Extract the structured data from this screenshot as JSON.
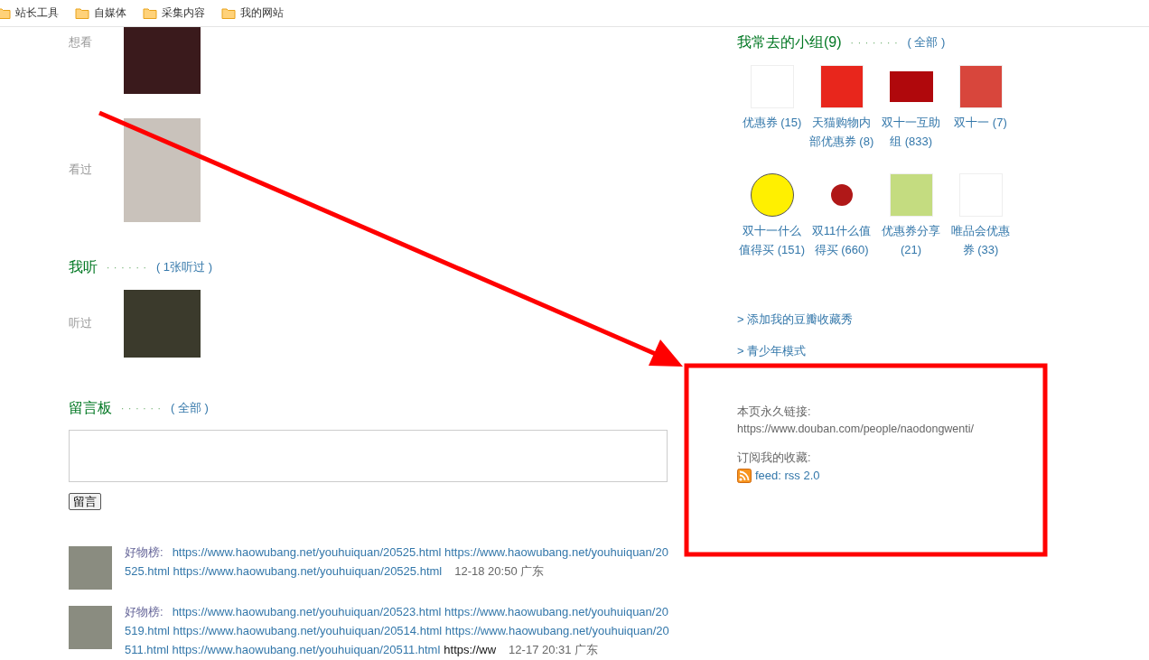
{
  "bookmarks": [
    {
      "label": "站长工具"
    },
    {
      "label": "自媒体"
    },
    {
      "label": "采集内容"
    },
    {
      "label": "我的网站"
    }
  ],
  "watch": {
    "rows": [
      {
        "label": "想看"
      },
      {
        "label": "看过"
      }
    ]
  },
  "listen": {
    "title": "我听",
    "dots": "· · · · · ·",
    "link": "( 1张听过 )",
    "rows": [
      {
        "label": "听过"
      }
    ]
  },
  "board": {
    "title": "留言板",
    "dots": "· · · · · ·",
    "link": "( 全部 )",
    "submit": "留言"
  },
  "comments": [
    {
      "author": "好物榜:",
      "links": "https://www.haowubang.net/youhuiquan/20525.html https://www.haowubang.net/youhuiquan/20525.html https://www.haowubang.net/youhuiquan/20525.html",
      "meta": "12-18 20:50 广东"
    },
    {
      "author": "好物榜:",
      "links": "https://www.haowubang.net/youhuiquan/20523.html https://www.haowubang.net/youhuiquan/20519.html https://www.haowubang.net/youhuiquan/20514.html https://www.haowubang.net/youhuiquan/20511.html https://www.haowubang.net/youhuiquan/20511.html",
      "tail": "https://ww",
      "meta": "12-17 20:31 广东"
    }
  ],
  "groups": {
    "title": "我常去的小组(9)",
    "dots": "· · · · · · ·",
    "link": "( 全部 )",
    "items": [
      {
        "name": "优惠券 (15)",
        "color": "#ffffff",
        "kind": "square"
      },
      {
        "name": "天猫购物内部优惠券 (8)",
        "color": "#e8261c",
        "kind": "square"
      },
      {
        "name": "双十一互助组 (833)",
        "color": "#b0080c",
        "kind": "wide"
      },
      {
        "name": "双十一 (7)",
        "color": "#d8463c",
        "kind": "square"
      },
      {
        "name": "双十一什么值得买 (151)",
        "color": "#fff000",
        "kind": "circle"
      },
      {
        "name": "双11什么值得买 (660)",
        "color": "#b01818",
        "kind": "dot"
      },
      {
        "name": "优惠券分享 (21)",
        "color": "#c4dc80",
        "kind": "square"
      },
      {
        "name": "唯品会优惠券 (33)",
        "color": "#ffffff",
        "kind": "square"
      }
    ]
  },
  "side_links": [
    "> 添加我的豆瓣收藏秀",
    "> 青少年模式"
  ],
  "permalink": {
    "label": "本页永久链接:",
    "url": "https://www.douban.com/people/naodongwenti/"
  },
  "subscribe": {
    "label": "订阅我的收藏:",
    "feed": "feed: rss 2.0"
  }
}
